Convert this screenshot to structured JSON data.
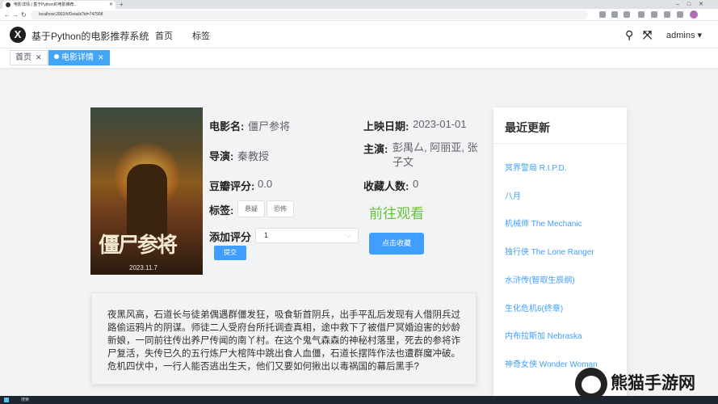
{
  "browser": {
    "tab_title": "电影详情 | 基于Python的电影推荐...",
    "url": "localhost:2002/#/Details?id=747908"
  },
  "header": {
    "logo_letter": "X",
    "title": "基于Python的电影推荐系统",
    "nav": [
      "首页",
      "标签"
    ],
    "user": "admins ▾"
  },
  "tags_view": {
    "tags": [
      {
        "label": "首页",
        "active": false
      },
      {
        "label": "电影详情",
        "active": true
      }
    ]
  },
  "movie": {
    "poster_title": "僵尸参将",
    "poster_date": "2023.11.7",
    "name_label": "电影名:",
    "name": "僵尸参将",
    "release_label": "上映日期:",
    "release": "2023-01-01",
    "director_label": "导演:",
    "director": "秦教授",
    "actors_label": "主演:",
    "actors": "彭禺厶, 阿丽亚, 张子文",
    "rating_label": "豆瓣评分:",
    "rating": "0.0",
    "fav_label": "收藏人数:",
    "fav_count": "0",
    "tags_label": "标签:",
    "tags": [
      "悬疑",
      "恐怖"
    ],
    "add_rating_label": "添加评分",
    "rating_select": "1",
    "submit_label": "提交",
    "watch_label": "前往观看",
    "collect_label": "点击收藏",
    "description": "夜黑风高，石道长与徒弟偶遇群僵发狂，吸食斩首阴兵，出手平乱后发现有人借阴兵过路偷运鸦片的阴谋。师徒二人受府台所托调查真相，途中救下了被借尸冥婚迫害的妙龄新娘，一同前往传出养尸传闻的南丫村。在这个鬼气森森的神秘村落里，死去的参将诈尸复活，失传已久的五行炼尸大棺阵中跳出食人血僵，石道长摆阵作法也遭群魔冲破。危机四伏中，一行人能否逃出生天，他们又要如何揪出以毒祸国的幕后黑手?"
  },
  "sidebar": {
    "title": "最近更新",
    "items": [
      "冥界警局 R.I.P.D.",
      "八月",
      "机械师 The Mechanic",
      "独行侠 The Lone Ranger",
      "水浒传(智取生辰纲)",
      "生化危机6(终章)",
      "内布拉斯加 Nebraska",
      "神奇女侠 Wonder Woman"
    ]
  },
  "taskbar": {
    "search": "搜索"
  },
  "watermark": {
    "text": "熊猫手游网"
  },
  "colors": {
    "accent": "#409eff",
    "tag_active": "#42a5f5",
    "watch_green": "#67c23a"
  }
}
